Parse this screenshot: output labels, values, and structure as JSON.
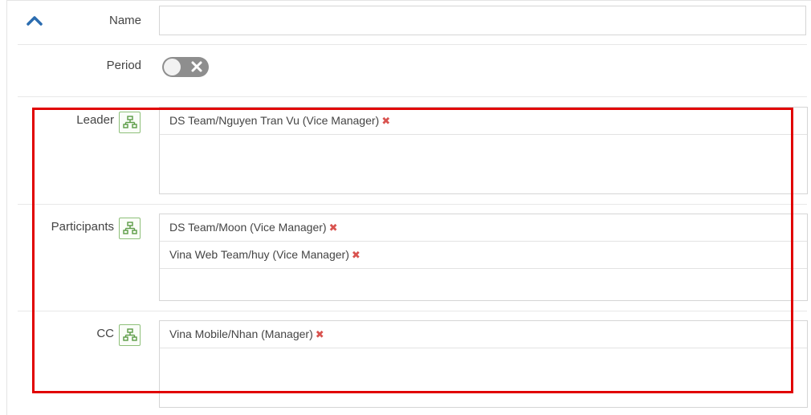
{
  "form": {
    "name": {
      "label": "Name",
      "value": "",
      "placeholder": ""
    },
    "period": {
      "label": "Period",
      "enabled": false
    },
    "leader": {
      "label": "Leader",
      "items": [
        {
          "text": "DS Team/Nguyen Tran Vu (Vice Manager)"
        }
      ]
    },
    "participants": {
      "label": "Participants",
      "items": [
        {
          "text": "DS Team/Moon (Vice Manager)"
        },
        {
          "text": "Vina Web Team/huy (Vice Manager)"
        }
      ]
    },
    "cc": {
      "label": "CC",
      "items": [
        {
          "text": "Vina Mobile/Nhan (Manager)"
        }
      ]
    }
  },
  "icons": {
    "collapse": "chevron-up-icon",
    "org_chart": "org-chart-icon",
    "remove": "remove-icon",
    "toggle_off": "close-icon"
  },
  "colors": {
    "chevron": "#2b6cb0",
    "remove": "#d9534f",
    "org_button_border": "#8ec07a",
    "highlight": "#e10000",
    "toggle_off": "#8e8e8e"
  }
}
